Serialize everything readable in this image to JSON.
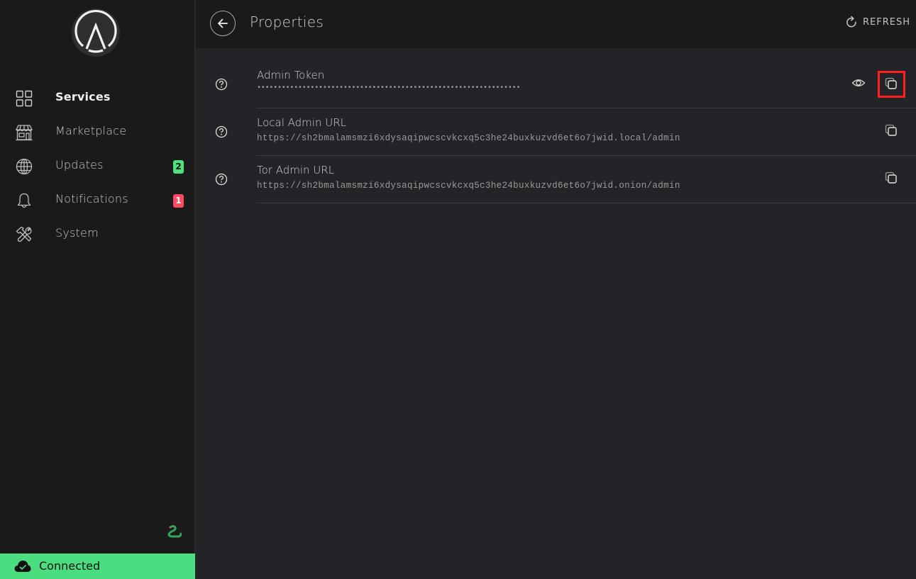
{
  "sidebar": {
    "logo": "start9-logo",
    "items": [
      {
        "label": "Services",
        "icon": "grid-icon",
        "active": true
      },
      {
        "label": "Marketplace",
        "icon": "storefront-icon",
        "active": false
      },
      {
        "label": "Updates",
        "icon": "globe-icon",
        "active": false,
        "badge": "2",
        "badge_color": "#4ee07d"
      },
      {
        "label": "Notifications",
        "icon": "bell-icon",
        "active": false,
        "badge": "1",
        "badge_color": "#ff4961"
      },
      {
        "label": "System",
        "icon": "tools-icon",
        "active": false
      }
    ],
    "footer_icon": "snake-icon",
    "connection_status": "Connected",
    "connection_color": "#4ade80"
  },
  "header": {
    "title": "Properties",
    "refresh_label": "REFRESH"
  },
  "properties": [
    {
      "label": "Admin Token",
      "value": "••••••••••••••••••••••••••••••••••••••••••••••••••••••••••••••••",
      "masked": true,
      "actions": [
        "show",
        "copy"
      ]
    },
    {
      "label": "Local Admin URL",
      "value": "https://sh2bmalamsmzi6xdysaqipwcscvkcxq5c3he24buxkuzvd6et6o7jwid.local/admin",
      "masked": false,
      "actions": [
        "copy"
      ]
    },
    {
      "label": "Tor Admin URL",
      "value": "https://sh2bmalamsmzi6xdysaqipwcscvkcxq5c3he24buxkuzvd6et6o7jwid.onion/admin",
      "masked": false,
      "actions": [
        "copy"
      ]
    }
  ],
  "highlight_color": "#ff1e1e"
}
